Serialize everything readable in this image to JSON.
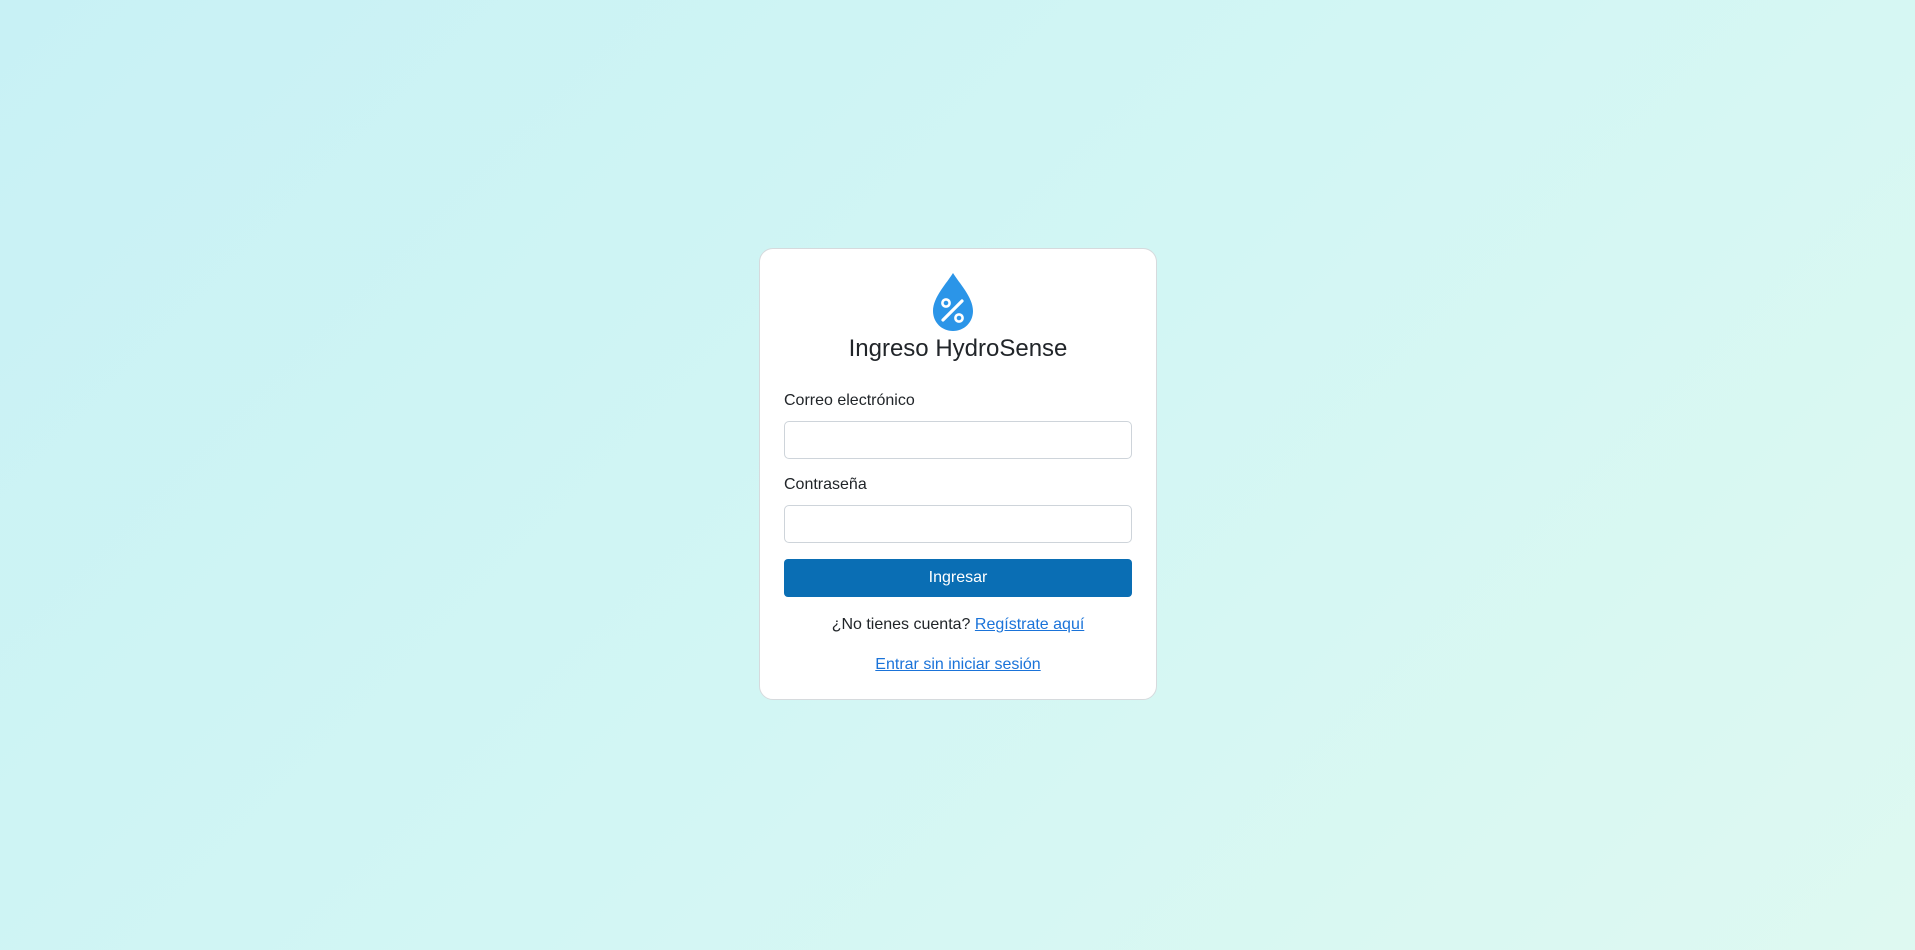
{
  "login": {
    "title": "Ingreso HydroSense",
    "logo_icon": "water-percent-icon",
    "logo_color": "#2b95e8",
    "email_label": "Correo electrónico",
    "email_value": "",
    "email_placeholder": "",
    "password_label": "Contraseña",
    "password_value": "",
    "password_placeholder": "",
    "submit_label": "Ingresar",
    "register_prompt": "¿No tienes cuenta?",
    "register_link": "Regístrate aquí",
    "guest_link": "Entrar sin iniciar sesión"
  },
  "colors": {
    "primary_button": "#0a6eb4",
    "link": "#1a73d9",
    "background_start": "#c8f1f5",
    "background_end": "#def9f1"
  }
}
